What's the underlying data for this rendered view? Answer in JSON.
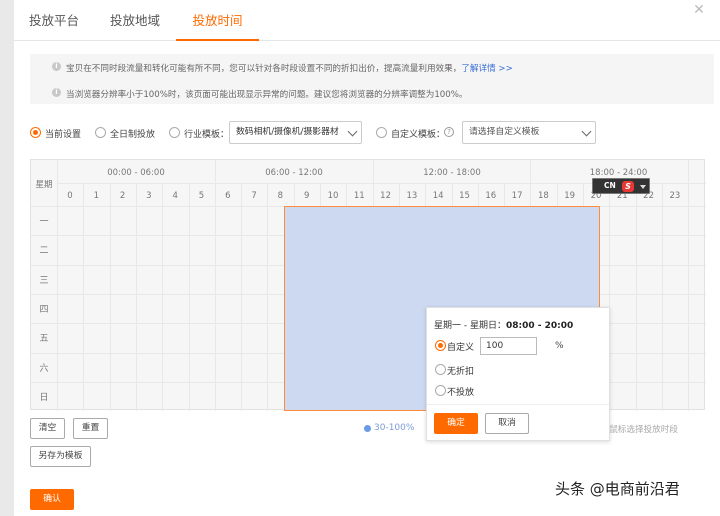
{
  "tabs": [
    "投放平台",
    "投放地域",
    "投放时间"
  ],
  "active_tab": "投放时间",
  "accent_color": "#ff6a00",
  "notice": {
    "line1": "宝贝在不同时段流量和转化可能有所不同，您可以针对各时段设置不同的折扣出价，提高流量利用效果，",
    "line1_link": "了解详情 >>",
    "line2": "当浏览器分辨率小于100%时，该页面可能出现显示异常的问题。建议您将浏览器的分辨率调整为100%。"
  },
  "options": {
    "current": "当前设置",
    "all_day": "全日制投放",
    "industry_label": "行业模板：",
    "industry_value": "数码相机/摄像机/摄影器材",
    "custom_label": "自定义模板：",
    "custom_placeholder": "请选择自定义模板",
    "selected": "当前设置"
  },
  "grid": {
    "week_label": "星期",
    "ranges": [
      "00:00 - 06:00",
      "06:00 - 12:00",
      "12:00 - 18:00",
      "18:00 - 24:00"
    ],
    "hours": [
      "0",
      "1",
      "2",
      "3",
      "4",
      "5",
      "6",
      "7",
      "8",
      "9",
      "10",
      "11",
      "12",
      "13",
      "14",
      "15",
      "16",
      "17",
      "18",
      "19",
      "20",
      "21",
      "22",
      "23"
    ],
    "days": [
      "一",
      "二",
      "三",
      "四",
      "五",
      "六",
      "日"
    ],
    "selection": {
      "from_hour": 8,
      "to_hour": 20,
      "days": "一 - 日"
    }
  },
  "ime": {
    "cn": "CN",
    "s": "S"
  },
  "buttons": {
    "clear": "清空",
    "reset": "重置",
    "save_template": "另存为模板",
    "confirm": "确认"
  },
  "legend": {
    "label": "30-100%"
  },
  "hint": "拖拽鼠标选择投放时段",
  "popup": {
    "title_prefix": "星期一 - 星期日：",
    "time": "08:00 - 20:00",
    "custom": "自定义",
    "value": "100",
    "percent": "%",
    "no_discount": "无折扣",
    "no_delivery": "不投放",
    "ok": "确定",
    "cancel": "取消",
    "selected": "自定义"
  },
  "watermark": "头条 @电商前沿君"
}
